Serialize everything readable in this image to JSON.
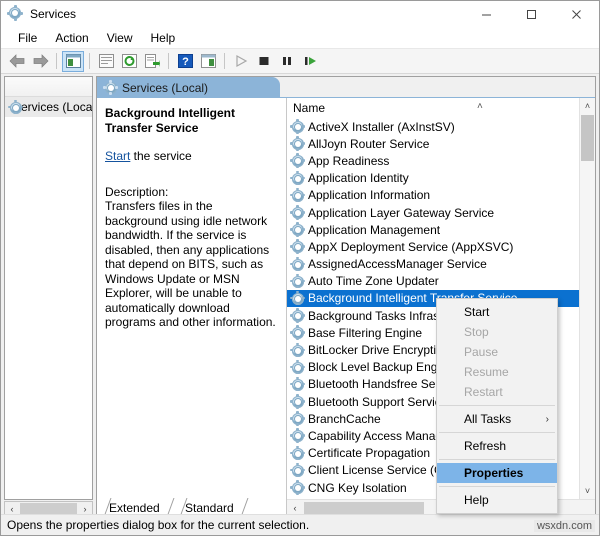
{
  "window": {
    "title": "Services",
    "title_icon": "services-gear-icon",
    "minimize_label": "—",
    "maximize_label": "☐",
    "close_label": "✕"
  },
  "menubar": {
    "items": [
      {
        "label": "File"
      },
      {
        "label": "Action"
      },
      {
        "label": "View"
      },
      {
        "label": "Help"
      }
    ]
  },
  "toolbar": {
    "buttons": [
      {
        "name": "back-button",
        "icon": "left-arrow-icon"
      },
      {
        "name": "forward-button",
        "icon": "right-arrow-icon"
      },
      {
        "name": "show-hide-tree-button",
        "icon": "tree-panel-icon"
      },
      {
        "name": "properties-button",
        "icon": "properties-icon"
      },
      {
        "name": "refresh-button",
        "icon": "refresh-icon"
      },
      {
        "name": "export-list-button",
        "icon": "export-icon"
      },
      {
        "name": "help-button",
        "icon": "question-mark-icon"
      },
      {
        "name": "show-action-pane-button",
        "icon": "action-pane-icon"
      },
      {
        "name": "start-service-button",
        "icon": "play-icon"
      },
      {
        "name": "stop-service-button",
        "icon": "stop-icon"
      },
      {
        "name": "pause-service-button",
        "icon": "pause-icon"
      },
      {
        "name": "restart-service-button",
        "icon": "restart-icon"
      }
    ]
  },
  "tree": {
    "node_label": "Services (Loca",
    "node_icon": "services-gear-icon",
    "scroll_left_label": "‹",
    "scroll_right_label": "›"
  },
  "content": {
    "tab_label": "Services (Local)",
    "tab_icon": "services-gear-icon"
  },
  "details": {
    "service_name": "Background Intelligent Transfer Service",
    "start_link": "Start",
    "start_suffix": " the service",
    "description_label": "Description:",
    "description": "Transfers files in the background using idle network bandwidth. If the service is disabled, then any applications that depend on BITS, such as Windows Update or MSN Explorer, will be unable to automatically download programs and other information."
  },
  "list": {
    "column_header": "Name",
    "sort_indicator": "˄",
    "rows": [
      {
        "label": "ActiveX Installer (AxInstSV)",
        "selected": false
      },
      {
        "label": "AllJoyn Router Service",
        "selected": false
      },
      {
        "label": "App Readiness",
        "selected": false
      },
      {
        "label": "Application Identity",
        "selected": false
      },
      {
        "label": "Application Information",
        "selected": false
      },
      {
        "label": "Application Layer Gateway Service",
        "selected": false
      },
      {
        "label": "Application Management",
        "selected": false
      },
      {
        "label": "AppX Deployment Service (AppXSVC)",
        "selected": false
      },
      {
        "label": "AssignedAccessManager Service",
        "selected": false
      },
      {
        "label": "Auto Time Zone Updater",
        "selected": false
      },
      {
        "label": "Background Intelligent Transfer Service",
        "selected": true
      },
      {
        "label": "Background Tasks Infrastructure Service",
        "selected": false
      },
      {
        "label": "Base Filtering Engine",
        "selected": false
      },
      {
        "label": "BitLocker Drive Encryption Service",
        "selected": false
      },
      {
        "label": "Block Level Backup Engine Service",
        "selected": false
      },
      {
        "label": "Bluetooth Handsfree Service",
        "selected": false
      },
      {
        "label": "Bluetooth Support Service",
        "selected": false
      },
      {
        "label": "BranchCache",
        "selected": false
      },
      {
        "label": "Capability Access Manager Service",
        "selected": false
      },
      {
        "label": "Certificate Propagation",
        "selected": false
      },
      {
        "label": "Client License Service (ClipSVC)",
        "selected": false
      },
      {
        "label": "CNG Key Isolation",
        "selected": false
      }
    ],
    "scroll_up_label": "˄",
    "scroll_down_label": "˅",
    "scroll_left_label": "‹",
    "scroll_right_label": "›"
  },
  "bottom_tabs": [
    {
      "label": "Extended",
      "active": false
    },
    {
      "label": "Standard",
      "active": true
    }
  ],
  "statusbar": {
    "text": "Opens the properties dialog box for the current selection."
  },
  "watermark": {
    "text": "wsxdn.com"
  },
  "context_menu": {
    "items": [
      {
        "label": "Start",
        "disabled": false,
        "highlight": false,
        "submenu": false,
        "separator_after": false
      },
      {
        "label": "Stop",
        "disabled": true,
        "highlight": false,
        "submenu": false,
        "separator_after": false
      },
      {
        "label": "Pause",
        "disabled": true,
        "highlight": false,
        "submenu": false,
        "separator_after": false
      },
      {
        "label": "Resume",
        "disabled": true,
        "highlight": false,
        "submenu": false,
        "separator_after": false
      },
      {
        "label": "Restart",
        "disabled": true,
        "highlight": false,
        "submenu": false,
        "separator_after": true
      },
      {
        "label": "All Tasks",
        "disabled": false,
        "highlight": false,
        "submenu": true,
        "separator_after": true
      },
      {
        "label": "Refresh",
        "disabled": false,
        "highlight": false,
        "submenu": false,
        "separator_after": true
      },
      {
        "label": "Properties",
        "disabled": false,
        "highlight": true,
        "submenu": false,
        "separator_after": true
      },
      {
        "label": "Help",
        "disabled": false,
        "highlight": false,
        "submenu": false,
        "separator_after": false
      }
    ],
    "submenu_arrow": "›"
  },
  "colors": {
    "selection_blue": "#0b71d0",
    "tab_blue": "#8cb4d8",
    "menu_highlight": "#7db4e8",
    "link_blue": "#15539e"
  }
}
